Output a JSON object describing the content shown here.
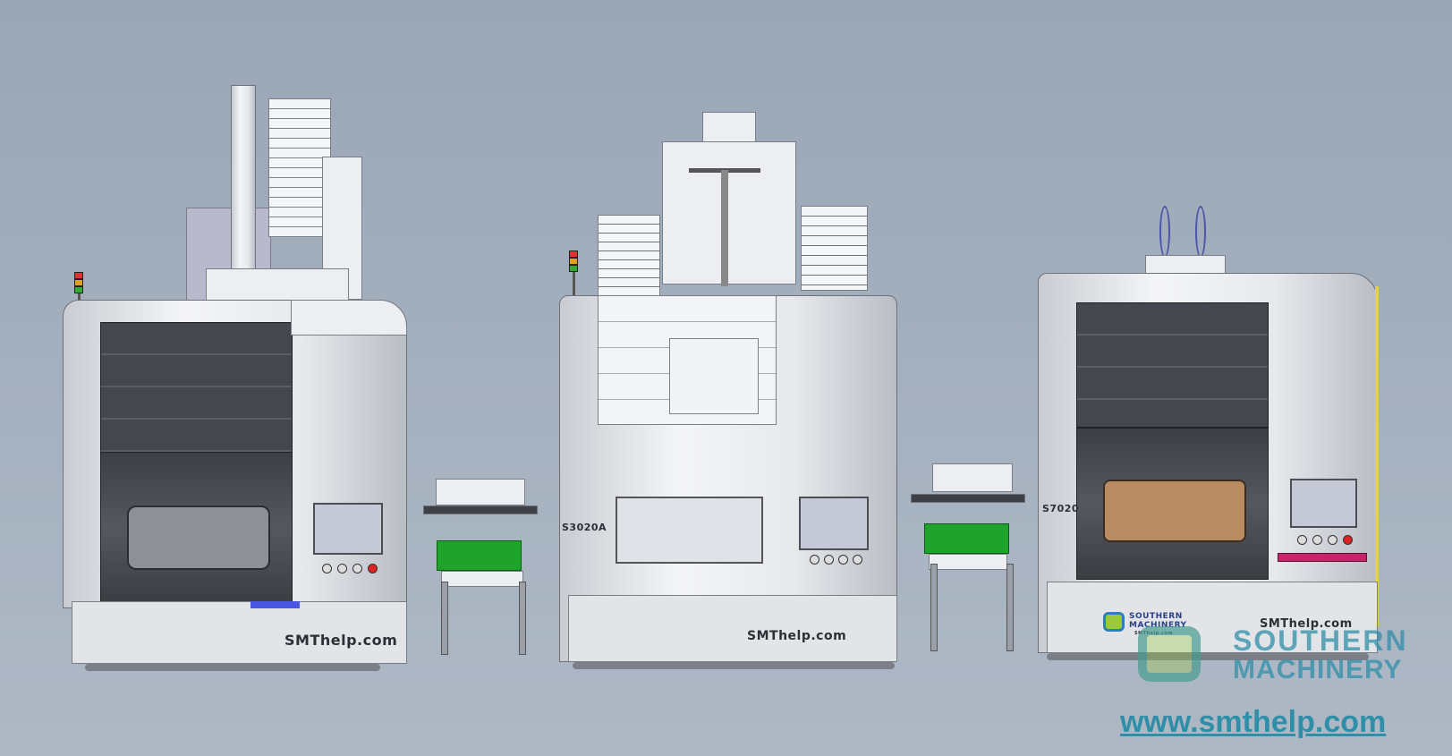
{
  "scene": "SMT production line CAD render",
  "machines": [
    {
      "id": "left-machine",
      "brand_label": "SMThelp.com"
    },
    {
      "id": "center-machine",
      "model_label": "S3020A",
      "brand_label": "SMThelp.com"
    },
    {
      "id": "right-machine",
      "model_label": "S7020",
      "brand_label": "SMThelp.com",
      "logo_text": "SOUTHERN MACHINERY",
      "logo_small": "SMThelp.com"
    }
  ],
  "watermark": {
    "line1": "SOUTHERN",
    "line2": "MACHINERY",
    "url": "www.smthelp.com",
    "color": "#2f8fa8"
  },
  "colors": {
    "background": "#a3adbb",
    "conveyor_green": "#1fa32b",
    "tray_tan": "#b98b62"
  }
}
